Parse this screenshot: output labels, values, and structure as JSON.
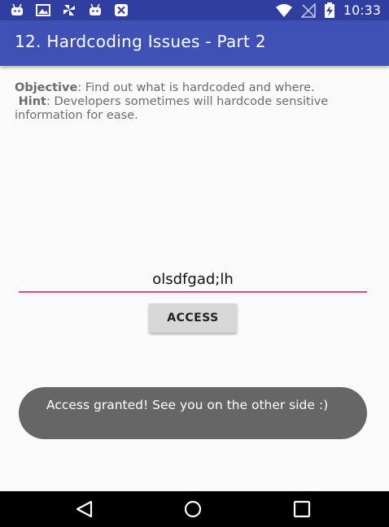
{
  "status_bar": {
    "time": "10:33",
    "icons": [
      "android-robot-icon",
      "image-icon",
      "pinwheel-icon",
      "android-robot-icon",
      "close-box-icon",
      "wifi-icon",
      "no-sim-icon",
      "battery-charging-icon"
    ],
    "color": "#303f9f"
  },
  "app_bar": {
    "title": "12. Hardcoding Issues - Part 2",
    "color": "#3f51b5"
  },
  "description": {
    "objective_label": "Objective",
    "objective_text": ": Find out what is hardcoded and where.",
    "hint_label": "Hint",
    "hint_text": ": Developers sometimes will hardcode sensitive information for ease."
  },
  "input": {
    "value": "olsdfgad;lh",
    "underline_color": "#e0467f"
  },
  "access_button": {
    "label": "ACCESS"
  },
  "toast": {
    "message": "Access granted! See you on the other side :)"
  },
  "nav_bar": {
    "buttons": [
      "back-icon",
      "home-icon",
      "recent-apps-icon"
    ]
  }
}
